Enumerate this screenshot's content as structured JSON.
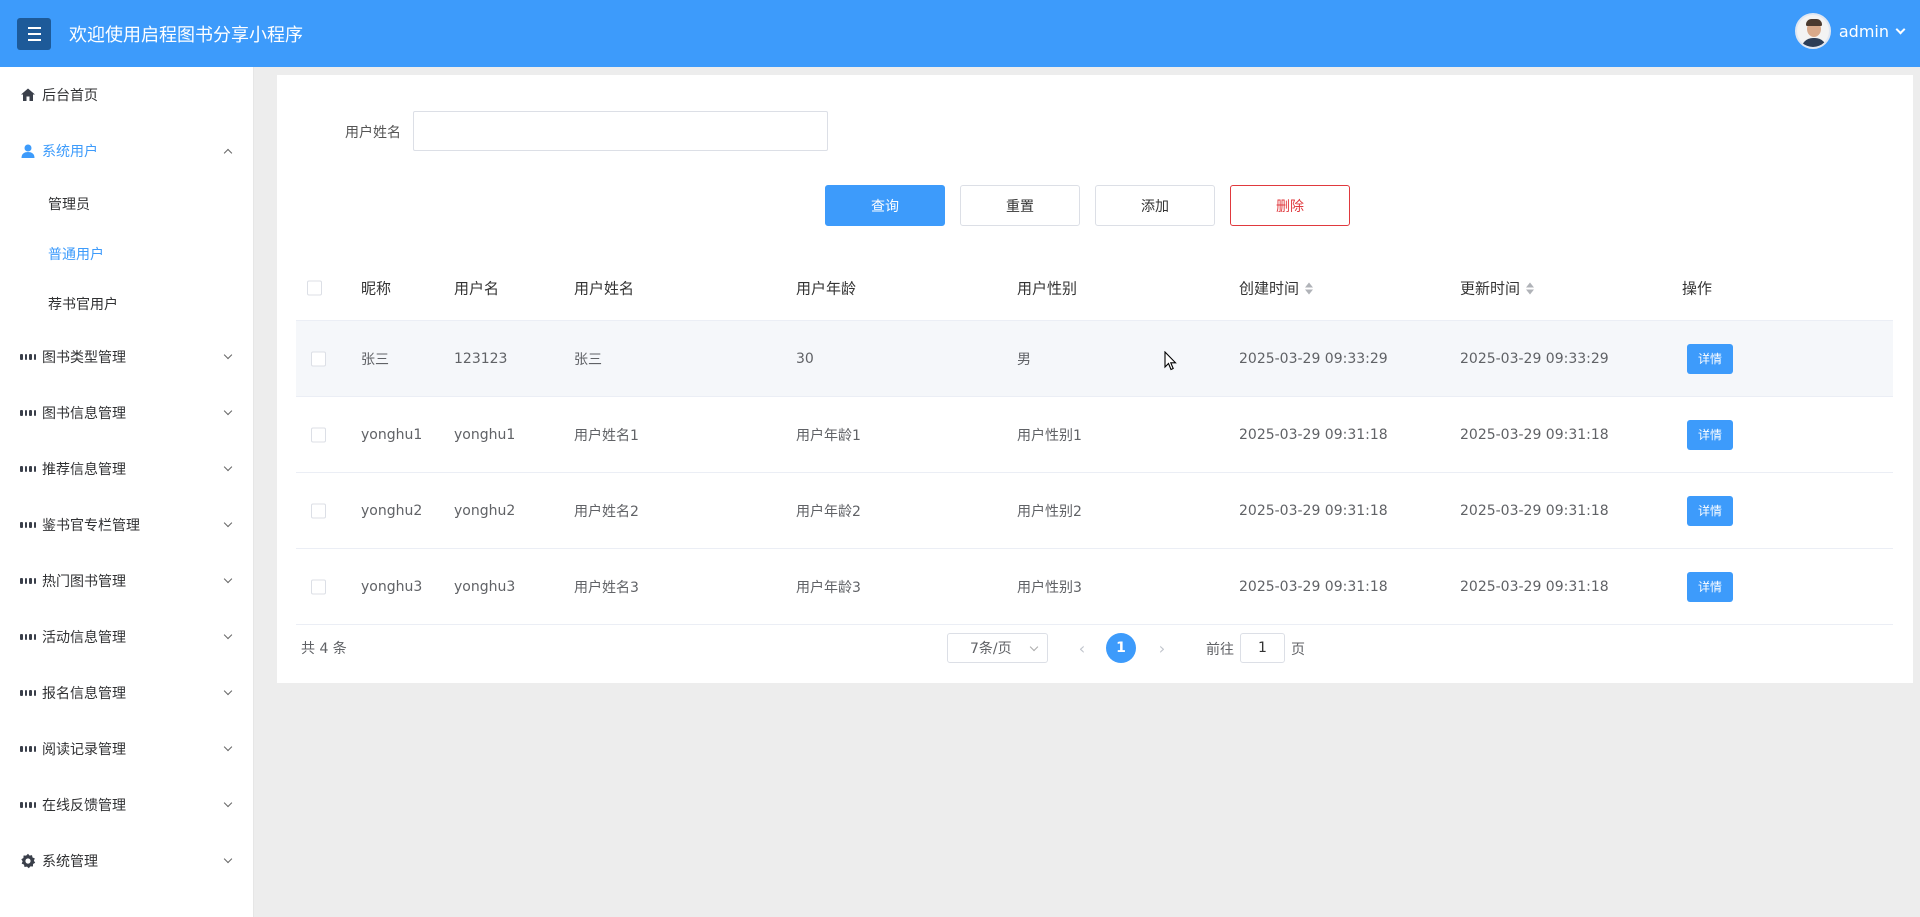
{
  "header": {
    "title": "欢迎使用启程图书分享小程序",
    "user": "admin"
  },
  "sidebar": {
    "items": [
      {
        "label": "后台首页",
        "icon": "home-icon"
      },
      {
        "label": "系统用户",
        "icon": "user-icon",
        "expanded": true,
        "children": [
          {
            "label": "管理员"
          },
          {
            "label": "普通用户",
            "active": true
          },
          {
            "label": "荐书官用户"
          }
        ]
      },
      {
        "label": "图书类型管理",
        "icon": "grid-icon"
      },
      {
        "label": "图书信息管理",
        "icon": "grid-icon"
      },
      {
        "label": "推荐信息管理",
        "icon": "grid-icon"
      },
      {
        "label": "鉴书官专栏管理",
        "icon": "grid-icon"
      },
      {
        "label": "热门图书管理",
        "icon": "grid-icon"
      },
      {
        "label": "活动信息管理",
        "icon": "grid-icon"
      },
      {
        "label": "报名信息管理",
        "icon": "grid-icon"
      },
      {
        "label": "阅读记录管理",
        "icon": "grid-icon"
      },
      {
        "label": "在线反馈管理",
        "icon": "grid-icon"
      },
      {
        "label": "系统管理",
        "icon": "gear-icon"
      }
    ]
  },
  "search": {
    "label": "用户姓名",
    "value": "",
    "placeholder": ""
  },
  "buttons": {
    "query": "查询",
    "reset": "重置",
    "add": "添加",
    "delete": "删除"
  },
  "table": {
    "columns": [
      "昵称",
      "用户名",
      "用户姓名",
      "用户年龄",
      "用户性别",
      "创建时间",
      "更新时间",
      "操作"
    ],
    "rows": [
      {
        "nickname": "张三",
        "username": "123123",
        "realname": "张三",
        "age": "30",
        "gender": "男",
        "created": "2025-03-29 09:33:29",
        "updated": "2025-03-29 09:33:29",
        "action": "详情"
      },
      {
        "nickname": "yonghu1",
        "username": "yonghu1",
        "realname": "用户姓名1",
        "age": "用户年龄1",
        "gender": "用户性别1",
        "created": "2025-03-29 09:31:18",
        "updated": "2025-03-29 09:31:18",
        "action": "详情"
      },
      {
        "nickname": "yonghu2",
        "username": "yonghu2",
        "realname": "用户姓名2",
        "age": "用户年龄2",
        "gender": "用户性别2",
        "created": "2025-03-29 09:31:18",
        "updated": "2025-03-29 09:31:18",
        "action": "详情"
      },
      {
        "nickname": "yonghu3",
        "username": "yonghu3",
        "realname": "用户姓名3",
        "age": "用户年龄3",
        "gender": "用户性别3",
        "created": "2025-03-29 09:31:18",
        "updated": "2025-03-29 09:31:18",
        "action": "详情"
      }
    ]
  },
  "pagination": {
    "total": "共 4 条",
    "page_size": "7条/页",
    "current": "1",
    "goto_label": "前往",
    "goto_value": "1",
    "goto_unit": "页"
  },
  "colors": {
    "primary": "#3d9bfb",
    "danger": "#e0393e",
    "header_bg": "#3d9bfb"
  }
}
